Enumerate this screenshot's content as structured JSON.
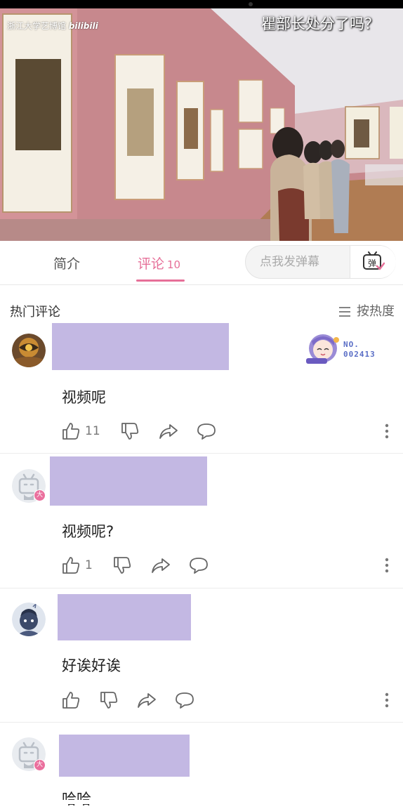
{
  "video": {
    "watermark": "浙江大学艺博馆",
    "watermark_brand": "bilibili",
    "subtitle": "瞿部长处分了吗？"
  },
  "tabs": {
    "intro_label": "简介",
    "comments_label": "评论",
    "comments_count": "10",
    "active_color": "#e66f98"
  },
  "danmu": {
    "placeholder": "点我发弹幕",
    "button_icon": "danmu-send-icon",
    "button_label": "弹"
  },
  "comments_header": {
    "title": "热门评论",
    "sort_label": "按热度",
    "sort_icon": "menu-lines-icon"
  },
  "badge": {
    "line1": "NO.",
    "line2": "002413"
  },
  "comments": [
    {
      "text": "视频呢",
      "likes": "11",
      "avatar": "avatar-1"
    },
    {
      "text": "视频呢?",
      "likes": "1",
      "avatar": "default-tv-avatar",
      "level": "大"
    },
    {
      "text": "好诶好诶",
      "likes": "",
      "avatar": "avatar-3"
    },
    {
      "text": "哈哈",
      "likes": "",
      "avatar": "default-tv-avatar",
      "level": "大"
    }
  ]
}
